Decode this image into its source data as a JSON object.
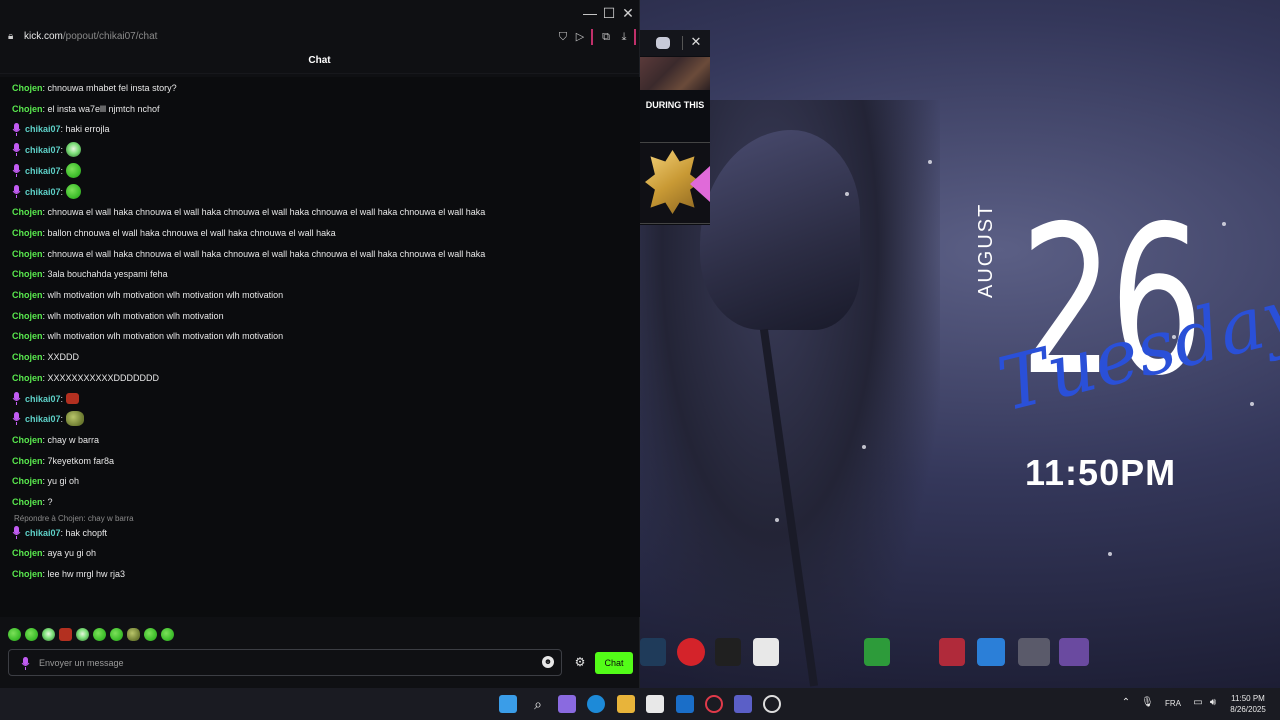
{
  "browser": {
    "url_host": "kick.com",
    "url_path": "/popout/chikai07/chat",
    "chat_title": "Chat"
  },
  "messages": [
    {
      "user": "Chojen",
      "color": "green",
      "text": ": chnouwa mhabet fel insta story?",
      "mic": false
    },
    {
      "user": "Chojen",
      "color": "green",
      "text": ": el insta wa7elll njmtch nchof",
      "mic": false
    },
    {
      "user": "chikai07",
      "color": "cyan",
      "text": ": haki errojla",
      "mic": true
    },
    {
      "user": "chikai07",
      "color": "cyan",
      "text": ":",
      "mic": true,
      "emote": "emote-alien"
    },
    {
      "user": "chikai07",
      "color": "cyan",
      "text": ":",
      "mic": true,
      "emote": "emote-pepe"
    },
    {
      "user": "chikai07",
      "color": "cyan",
      "text": ":",
      "mic": true,
      "emote": "emote-pepe"
    },
    {
      "user": "Chojen",
      "color": "green",
      "text": ": chnouwa el wall haka chnouwa el wall haka chnouwa el wall haka chnouwa el wall haka chnouwa el wall haka",
      "mic": false
    },
    {
      "user": "Chojen",
      "color": "green",
      "text": ": ballon chnouwa el wall haka chnouwa el wall haka chnouwa el wall haka",
      "mic": false
    },
    {
      "user": "Chojen",
      "color": "green",
      "text": ": chnouwa el wall haka chnouwa el wall haka chnouwa el wall haka chnouwa el wall haka chnouwa el wall haka",
      "mic": false
    },
    {
      "user": "Chojen",
      "color": "green",
      "text": ": 3ala bouchahda yespami feha",
      "mic": false
    },
    {
      "user": "Chojen",
      "color": "green",
      "text": ": wlh motivation wlh motivation wlh motivation wlh motivation",
      "mic": false
    },
    {
      "user": "Chojen",
      "color": "green",
      "text": ": wlh motivation wlh motivation wlh motivation",
      "mic": false
    },
    {
      "user": "Chojen",
      "color": "green",
      "text": ": wlh motivation wlh motivation wlh motivation wlh motivation",
      "mic": false
    },
    {
      "user": "Chojen",
      "color": "green",
      "text": ": XXDDD",
      "mic": false
    },
    {
      "user": "Chojen",
      "color": "green",
      "text": ": XXXXXXXXXXXDDDDDDD",
      "mic": false
    },
    {
      "user": "chikai07",
      "color": "cyan",
      "text": ":",
      "mic": true,
      "emote": "emote-red"
    },
    {
      "user": "chikai07",
      "color": "cyan",
      "text": ":",
      "mic": true,
      "emote": "emote-frog"
    },
    {
      "user": "Chojen",
      "color": "green",
      "text": ": chay w barra",
      "mic": false
    },
    {
      "user": "Chojen",
      "color": "green",
      "text": ": 7keyetkom far8a",
      "mic": false
    },
    {
      "user": "Chojen",
      "color": "green",
      "text": ": yu gi oh",
      "mic": false
    },
    {
      "user": "Chojen",
      "color": "green",
      "text": ": ?",
      "mic": false
    },
    {
      "user": "chikai07",
      "color": "cyan",
      "text": ": hak chopft",
      "mic": true
    },
    {
      "user": "Chojen",
      "color": "green",
      "text": ": aya yu gi oh",
      "mic": false
    },
    {
      "user": "Chojen",
      "color": "green",
      "text": ": lee hw mrgl hw rja3",
      "mic": false
    }
  ],
  "reply": "Répondre à Chojen: chay w barra",
  "input": {
    "placeholder": "Envoyer un message",
    "send_label": "Chat"
  },
  "side_panel": {
    "caption": "DURING THIS"
  },
  "clock": {
    "month": "AUGUST",
    "day": "26",
    "weekday": "Tuesday",
    "time": "11:50PM"
  },
  "tray": {
    "language": "FRA",
    "time": "11:50 PM",
    "date": "8/26/2025"
  },
  "colors": {
    "kick_green": "#53fc18",
    "user_green": "#59e84e",
    "user_cyan": "#5ed1c8"
  }
}
